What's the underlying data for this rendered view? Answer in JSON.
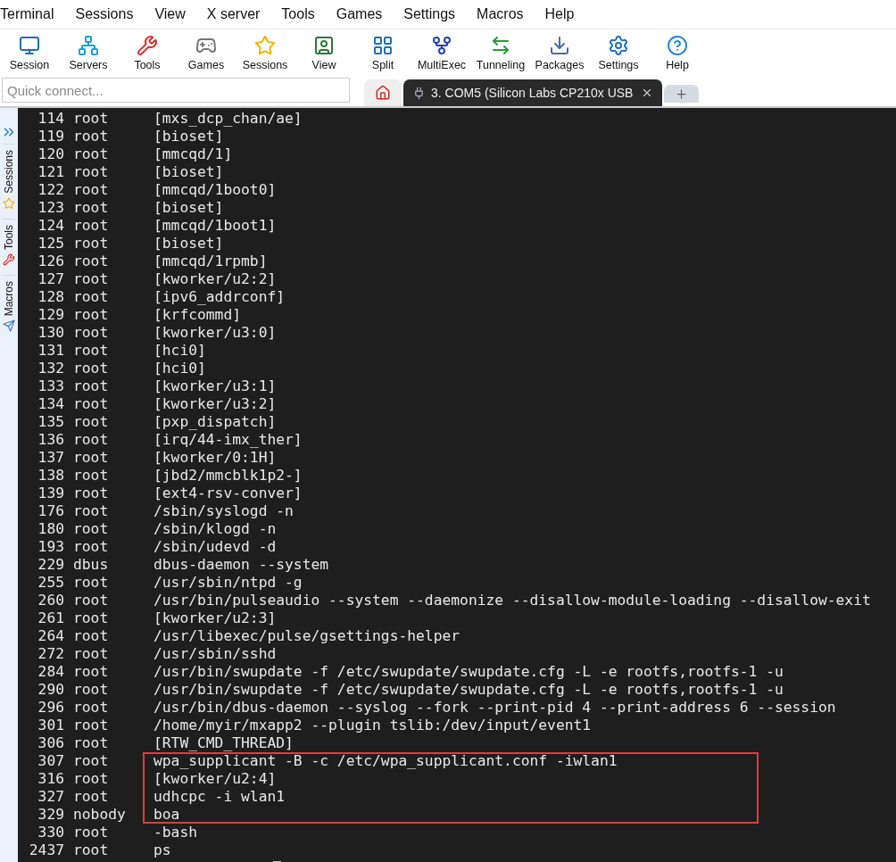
{
  "menu": [
    "Terminal",
    "Sessions",
    "View",
    "X server",
    "Tools",
    "Games",
    "Settings",
    "Macros",
    "Help"
  ],
  "toolbar": [
    {
      "kind": "session",
      "label": "Session"
    },
    {
      "kind": "servers",
      "label": "Servers"
    },
    {
      "kind": "tools",
      "label": "Tools"
    },
    {
      "kind": "games",
      "label": "Games"
    },
    {
      "kind": "sessions",
      "label": "Sessions"
    },
    {
      "kind": "view",
      "label": "View"
    },
    {
      "kind": "split",
      "label": "Split"
    },
    {
      "kind": "multiexec",
      "label": "MultiExec"
    },
    {
      "kind": "tunneling",
      "label": "Tunneling"
    },
    {
      "kind": "packages",
      "label": "Packages"
    },
    {
      "kind": "settings",
      "label": "Settings"
    },
    {
      "kind": "help",
      "label": "Help"
    }
  ],
  "quick_connect": {
    "placeholder": "Quick connect..."
  },
  "tabs": [
    {
      "kind": "home",
      "selected": false
    },
    {
      "kind": "serial",
      "label": "3. COM5  (Silicon Labs  CP210x USB",
      "selected": true
    },
    {
      "kind": "new",
      "selected": false
    }
  ],
  "sidebar": [
    {
      "kind": "sessions",
      "label": "Sessions"
    },
    {
      "kind": "tools",
      "label": "Tools"
    },
    {
      "kind": "macros",
      "label": "Macros"
    }
  ],
  "terminal": {
    "rows": [
      {
        "pid": "114",
        "user": "root",
        "command": "[mxs_dcp_chan/ae]",
        "boxed": false
      },
      {
        "pid": "119",
        "user": "root",
        "command": "[bioset]",
        "boxed": false
      },
      {
        "pid": "120",
        "user": "root",
        "command": "[mmcqd/1]",
        "boxed": false
      },
      {
        "pid": "121",
        "user": "root",
        "command": "[bioset]",
        "boxed": false
      },
      {
        "pid": "122",
        "user": "root",
        "command": "[mmcqd/1boot0]",
        "boxed": false
      },
      {
        "pid": "123",
        "user": "root",
        "command": "[bioset]",
        "boxed": false
      },
      {
        "pid": "124",
        "user": "root",
        "command": "[mmcqd/1boot1]",
        "boxed": false
      },
      {
        "pid": "125",
        "user": "root",
        "command": "[bioset]",
        "boxed": false
      },
      {
        "pid": "126",
        "user": "root",
        "command": "[mmcqd/1rpmb]",
        "boxed": false
      },
      {
        "pid": "127",
        "user": "root",
        "command": "[kworker/u2:2]",
        "boxed": false
      },
      {
        "pid": "128",
        "user": "root",
        "command": "[ipv6_addrconf]",
        "boxed": false
      },
      {
        "pid": "129",
        "user": "root",
        "command": "[krfcommd]",
        "boxed": false
      },
      {
        "pid": "130",
        "user": "root",
        "command": "[kworker/u3:0]",
        "boxed": false
      },
      {
        "pid": "131",
        "user": "root",
        "command": "[hci0]",
        "boxed": false
      },
      {
        "pid": "132",
        "user": "root",
        "command": "[hci0]",
        "boxed": false
      },
      {
        "pid": "133",
        "user": "root",
        "command": "[kworker/u3:1]",
        "boxed": false
      },
      {
        "pid": "134",
        "user": "root",
        "command": "[kworker/u3:2]",
        "boxed": false
      },
      {
        "pid": "135",
        "user": "root",
        "command": "[pxp_dispatch]",
        "boxed": false
      },
      {
        "pid": "136",
        "user": "root",
        "command": "[irq/44-imx_ther]",
        "boxed": false
      },
      {
        "pid": "137",
        "user": "root",
        "command": "[kworker/0:1H]",
        "boxed": false
      },
      {
        "pid": "138",
        "user": "root",
        "command": "[jbd2/mmcblk1p2-]",
        "boxed": false
      },
      {
        "pid": "139",
        "user": "root",
        "command": "[ext4-rsv-conver]",
        "boxed": false
      },
      {
        "pid": "176",
        "user": "root",
        "command": "/sbin/syslogd -n",
        "boxed": false
      },
      {
        "pid": "180",
        "user": "root",
        "command": "/sbin/klogd -n",
        "boxed": false
      },
      {
        "pid": "193",
        "user": "root",
        "command": "/sbin/udevd -d",
        "boxed": false
      },
      {
        "pid": "229",
        "user": "dbus",
        "command": "dbus-daemon --system",
        "boxed": false
      },
      {
        "pid": "255",
        "user": "root",
        "command": "/usr/sbin/ntpd -g",
        "boxed": false
      },
      {
        "pid": "260",
        "user": "root",
        "command": "/usr/bin/pulseaudio --system --daemonize --disallow-module-loading --disallow-exit",
        "boxed": false
      },
      {
        "pid": "261",
        "user": "root",
        "command": "[kworker/u2:3]",
        "boxed": false
      },
      {
        "pid": "264",
        "user": "root",
        "command": "/usr/libexec/pulse/gsettings-helper",
        "boxed": false
      },
      {
        "pid": "272",
        "user": "root",
        "command": "/usr/sbin/sshd",
        "boxed": false
      },
      {
        "pid": "284",
        "user": "root",
        "command": "/usr/bin/swupdate -f /etc/swupdate/swupdate.cfg -L -e rootfs,rootfs-1 -u",
        "boxed": false
      },
      {
        "pid": "290",
        "user": "root",
        "command": "/usr/bin/swupdate -f /etc/swupdate/swupdate.cfg -L -e rootfs,rootfs-1 -u",
        "boxed": false
      },
      {
        "pid": "296",
        "user": "root",
        "command": "/usr/bin/dbus-daemon --syslog --fork --print-pid 4 --print-address 6 --session",
        "boxed": false
      },
      {
        "pid": "301",
        "user": "root",
        "command": "/home/myir/mxapp2 --plugin tslib:/dev/input/event1",
        "boxed": false
      },
      {
        "pid": "306",
        "user": "root",
        "command": "[RTW_CMD_THREAD]",
        "boxed": false
      },
      {
        "pid": "307",
        "user": "root",
        "command": "wpa_supplicant -B -c /etc/wpa_supplicant.conf -iwlan1",
        "boxed": true
      },
      {
        "pid": "316",
        "user": "root",
        "command": "[kworker/u2:4]",
        "boxed": true
      },
      {
        "pid": "327",
        "user": "root",
        "command": "udhcpc -i wlan1",
        "boxed": true
      },
      {
        "pid": "329",
        "user": "nobody",
        "command": "boa",
        "boxed": true
      },
      {
        "pid": "330",
        "user": "root",
        "command": "-bash",
        "boxed": false
      },
      {
        "pid": "2437",
        "user": "root",
        "command": "ps",
        "boxed": false
      }
    ]
  }
}
